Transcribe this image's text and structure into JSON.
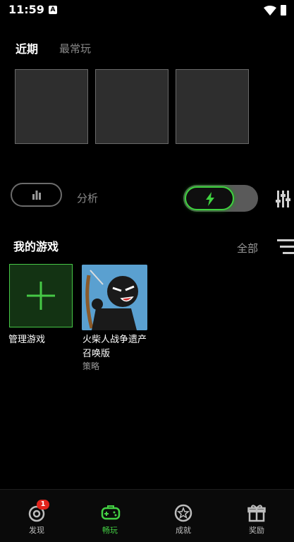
{
  "status_bar": {
    "time": "11:59",
    "notification_glyph": "A"
  },
  "tabs": {
    "recent": "近期",
    "frequent": "最常玩"
  },
  "controls": {
    "analysis_label": "分析"
  },
  "my_games": {
    "title": "我的游戏",
    "filter_label": "全部",
    "manage_label": "管理游戏",
    "games": [
      {
        "name": "火柴人战争遗产召唤版",
        "genre": "策略"
      }
    ]
  },
  "nav": {
    "items": [
      {
        "label": "发现",
        "icon": "discover-icon",
        "badge": "1"
      },
      {
        "label": "畅玩",
        "icon": "gamepad-icon",
        "active": true
      },
      {
        "label": "成就",
        "icon": "achievement-star-icon"
      },
      {
        "label": "奖励",
        "icon": "gift-icon"
      }
    ]
  },
  "colors": {
    "accent": "#44d144",
    "background": "#000000",
    "badge": "#e2241c"
  }
}
